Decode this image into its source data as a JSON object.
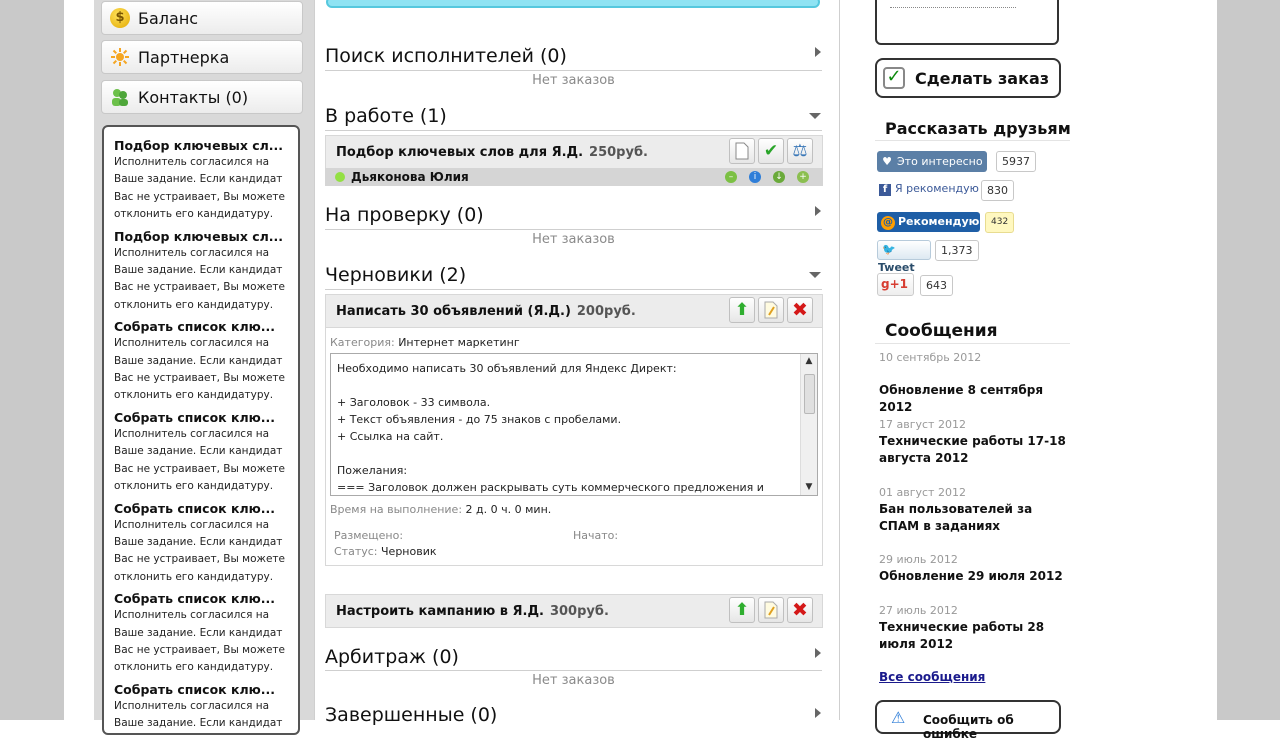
{
  "left_nav": {
    "items": [
      {
        "label": "Баланс",
        "icon": "coin-icon"
      },
      {
        "label": "Партнерка",
        "icon": "sun-icon"
      },
      {
        "label": "Контакты (0)",
        "icon": "users-icon"
      }
    ]
  },
  "messages": [
    {
      "title": "Подбор ключевых сл...",
      "body": "Исполнитель согласился на Ваше задание. Если кандидат Вас не устраивает, Вы можете отклонить его кандидатуру."
    },
    {
      "title": "Подбор ключевых сл...",
      "body": "Исполнитель согласился на Ваше задание. Если кандидат Вас не устраивает, Вы можете отклонить его кандидатуру."
    },
    {
      "title": "Собрать список клю...",
      "body": "Исполнитель согласился на Ваше задание. Если кандидат Вас не устраивает, Вы можете отклонить его кандидатуру."
    },
    {
      "title": "Собрать список клю...",
      "body": "Исполнитель согласился на Ваше задание. Если кандидат Вас не устраивает, Вы можете отклонить его кандидатуру."
    },
    {
      "title": "Собрать список клю...",
      "body": "Исполнитель согласился на Ваше задание. Если кандидат Вас не устраивает, Вы можете отклонить его кандидатуру."
    },
    {
      "title": "Собрать список клю...",
      "body": "Исполнитель согласился на Ваше задание. Если кандидат Вас не устраивает, Вы можете отклонить его кандидатуру."
    },
    {
      "title": "Собрать список клю...",
      "body": "Исполнитель согласился на Ваше задание. Если кандидат Вас не устраивает, Вы можете отклонить его кандидатуру."
    }
  ],
  "sections": {
    "search": {
      "title": "Поиск исполнителей (0)",
      "empty": "Нет заказов"
    },
    "in_work": {
      "title": "В работе (1)"
    },
    "review": {
      "title": "На проверку (0)",
      "empty": "Нет заказов"
    },
    "drafts": {
      "title": "Черновики (2)"
    },
    "arbitration": {
      "title": "Арбитраж (0)",
      "empty": "Нет заказов"
    },
    "completed": {
      "title": "Завершенные (0)"
    }
  },
  "in_work_order": {
    "name": "Подбор ключевых слов для Я.Д.",
    "price": "250руб.",
    "worker": "Дьяконова Юлия"
  },
  "draft_order_1": {
    "name": "Написать 30 объявлений (Я.Д.)",
    "price": "200руб.",
    "category_label": "Категория:",
    "category": "Интернет маркетинг",
    "description": "Необходимо написать 30 объявлений для Яндекс Директ:\n\n+ Заголовок - 33 символа.\n+ Текст объявления - до 75 знаков с пробелами.\n+ Ссылка на сайт.\n\nПожелания:\n=== Заголовок должен раскрывать суть коммерческого предложения и",
    "time_label": "Время на выполнение:",
    "time": "2 д. 0 ч. 0 мин.",
    "placed_label": "Размещено:",
    "started_label": "Начато:",
    "status_label": "Статус:",
    "status": "Черновик"
  },
  "draft_order_2": {
    "name": "Настроить кампанию в Я.Д.",
    "price": "300руб."
  },
  "right": {
    "order_button": "Сделать заказ",
    "share_heading": "Рассказать друзьям",
    "vk_label": "Это интересно",
    "vk_count": "5937",
    "fb_label": "Я рекомендую",
    "fb_count": "830",
    "mail_label": "Рекомендую",
    "mail_count": "432",
    "tweet_label": "Tweet",
    "tweet_count": "1,373",
    "gplus_label": "+1",
    "gplus_count": "643",
    "news_heading": "Сообщения",
    "news": [
      {
        "date": "10 сентябрь 2012",
        "title": "Обновление 8 сентября 2012"
      },
      {
        "date": "17 август 2012",
        "title": "Технические работы 17-18 августа 2012"
      },
      {
        "date": "01 август 2012",
        "title": "Бан пользователей за СПАМ в заданиях"
      },
      {
        "date": "29 июль 2012",
        "title": "Обновление 29 июля 2012"
      },
      {
        "date": "27 июль 2012",
        "title": "Технические работы 28 июля 2012"
      }
    ],
    "all_messages": "Все сообщения",
    "report_button": "Сообщить об ошибке"
  },
  "colors": {
    "accent_green": "#2aa52a",
    "accent_red": "#d41818",
    "vk_blue": "#5b7fa6",
    "mail_blue": "#1e5ea6",
    "banner_cyan": "#8fe3f3"
  }
}
